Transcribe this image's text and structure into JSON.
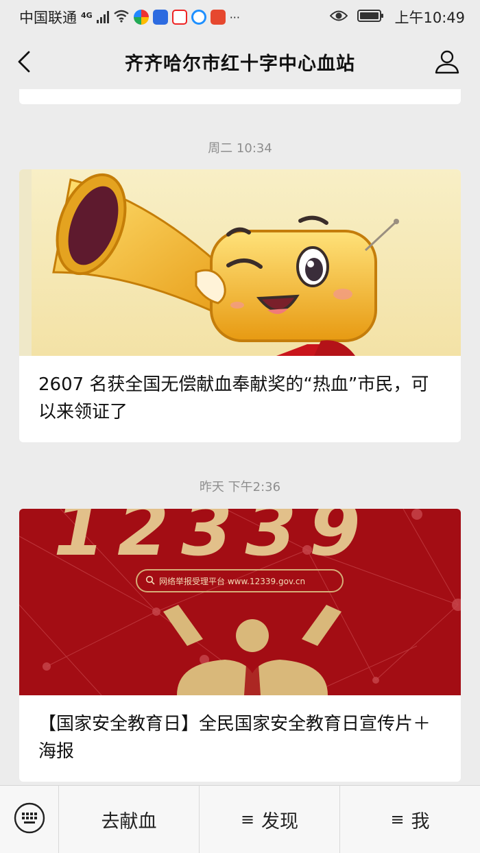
{
  "status_bar": {
    "carrier": "中国联通",
    "network": "4G",
    "time": "上午10:49",
    "more": "···"
  },
  "nav": {
    "title": "齐齐哈尔市红十字中心血站"
  },
  "feed": [
    {
      "timestamp": "周二 10:34",
      "title": "2607 名获全国无偿献血奉献奖的“热血”市民，可以来领证了"
    },
    {
      "timestamp": "昨天 下午2:36",
      "title": "【国家安全教育日】全民国家安全教育日宣传片＋海报",
      "image_text": {
        "hotline": "12339",
        "platform": "网络举报受理平台 www.12339.gov.cn"
      }
    }
  ],
  "menu": {
    "items": [
      {
        "label": "去献血",
        "has_submenu": false
      },
      {
        "label": "发现",
        "has_submenu": true,
        "glyph": "≡"
      },
      {
        "label": "我",
        "has_submenu": true,
        "glyph": "≡"
      }
    ]
  },
  "colors": {
    "background": "#ececec",
    "card": "#ffffff",
    "banner_red": "#a30d14",
    "gold": "#e8c07a"
  }
}
